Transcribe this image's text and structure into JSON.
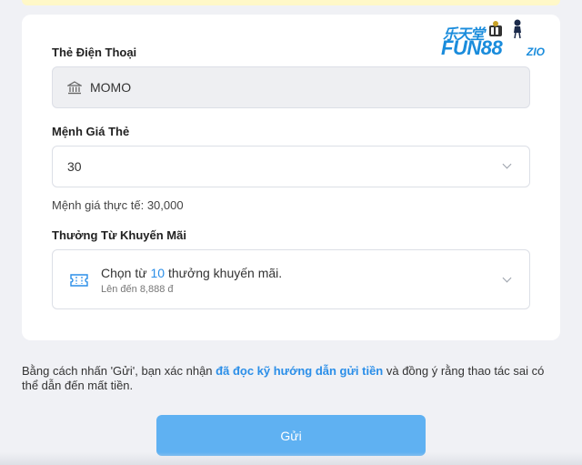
{
  "form": {
    "phone_card_label": "Thẻ Điện Thoại",
    "phone_card_value": "MOMO",
    "denomination_label": "Mệnh Giá Thẻ",
    "denomination_value": "30",
    "actual_value_text": "Mệnh giá thực tế: 30,000",
    "promo_label": "Thưởng Từ Khuyến Mãi",
    "promo_prefix": "Chọn từ ",
    "promo_count": "10",
    "promo_suffix": " thưởng khuyến mãi.",
    "promo_subtext": "Lên đến 8,888 đ"
  },
  "logo": {
    "cn": "乐天堂",
    "main": "FUN88",
    "suffix": "ZIO"
  },
  "disclaimer": {
    "before": "Bằng cách nhấn 'Gửi', bạn xác nhận ",
    "link": "đã đọc kỹ hướng dẫn gửi tiền",
    "after": " và đồng ý rằng thao tác sai có thể dẫn đến mất tiền."
  },
  "submit_label": "Gửi",
  "icons": {
    "bank": "bank-icon",
    "chevron": "chevron-down-icon",
    "ticket": "ticket-icon"
  },
  "colors": {
    "accent": "#2a8ee8",
    "button": "#5fb1f2",
    "brand": "#1a8cdc"
  }
}
